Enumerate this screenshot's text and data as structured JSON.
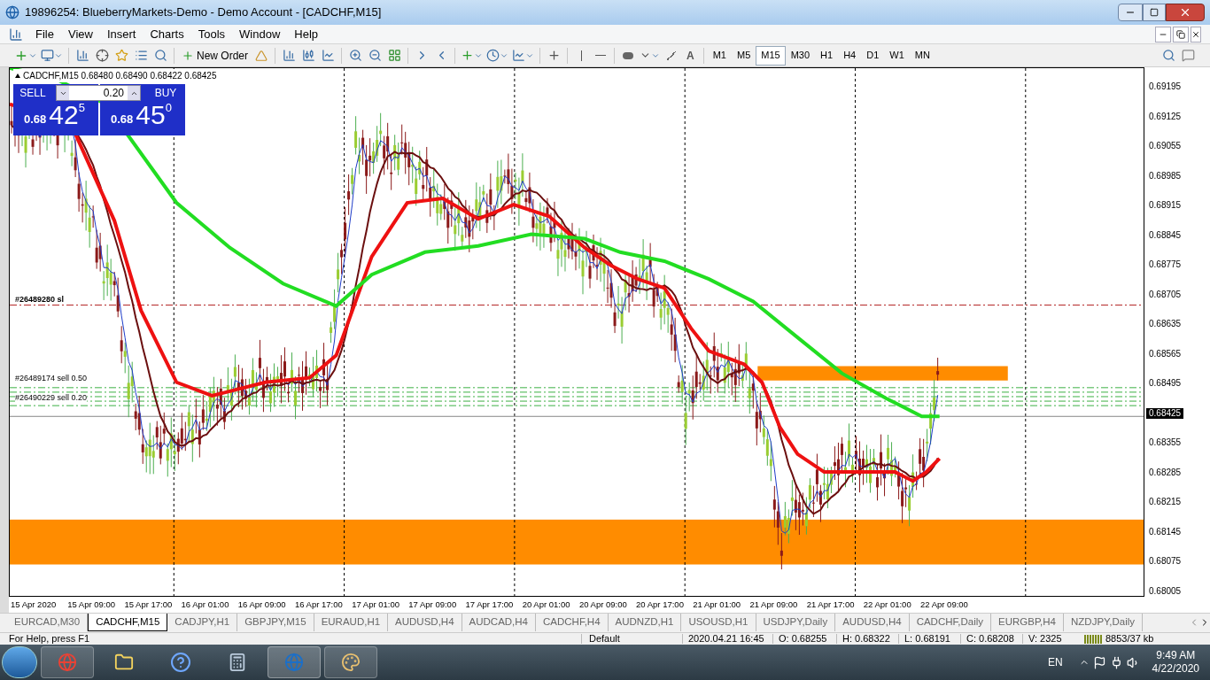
{
  "window": {
    "title": "19896254: BlueberryMarkets-Demo - Demo Account - [CADCHF,M15]"
  },
  "menu": [
    "File",
    "View",
    "Insert",
    "Charts",
    "Tools",
    "Window",
    "Help"
  ],
  "toolbar": {
    "new_order": "New Order",
    "timeframes": [
      {
        "label": "M1",
        "selected": false
      },
      {
        "label": "M5",
        "selected": false
      },
      {
        "label": "M15",
        "selected": true
      },
      {
        "label": "M30",
        "selected": false
      },
      {
        "label": "H1",
        "selected": false
      },
      {
        "label": "H4",
        "selected": false
      },
      {
        "label": "D1",
        "selected": false
      },
      {
        "label": "W1",
        "selected": false
      },
      {
        "label": "MN",
        "selected": false
      }
    ],
    "text_tool": "A"
  },
  "chart": {
    "header": "CADCHF,M15  0.68480 0.68490 0.68422 0.68425",
    "trade_panel": {
      "sell": "SELL",
      "buy": "BUY",
      "lot": "0.20",
      "bid": {
        "prefix": "0.68",
        "big": "42",
        "small": "5"
      },
      "ask": {
        "prefix": "0.68",
        "big": "45",
        "small": "0"
      }
    },
    "order_labels": [
      {
        "text": "#26489280 sl",
        "kind": "sl"
      },
      {
        "text": "#26489174 sell 0.50",
        "kind": "sell"
      },
      {
        "text": "#26490229 sell 0.20",
        "kind": "sell"
      }
    ],
    "price_axis": [
      {
        "label": "0.69195",
        "current": false
      },
      {
        "label": "0.69125",
        "current": false
      },
      {
        "label": "0.69055",
        "current": false
      },
      {
        "label": "0.68985",
        "current": false
      },
      {
        "label": "0.68915",
        "current": false
      },
      {
        "label": "0.68845",
        "current": false
      },
      {
        "label": "0.68775",
        "current": false
      },
      {
        "label": "0.68705",
        "current": false
      },
      {
        "label": "0.68635",
        "current": false
      },
      {
        "label": "0.68565",
        "current": false
      },
      {
        "label": "0.68495",
        "current": false
      },
      {
        "label": "0.68425",
        "current": true
      },
      {
        "label": "0.68355",
        "current": false
      },
      {
        "label": "0.68285",
        "current": false
      },
      {
        "label": "0.68215",
        "current": false
      },
      {
        "label": "0.68145",
        "current": false
      },
      {
        "label": "0.68075",
        "current": false
      },
      {
        "label": "0.68005",
        "current": false
      }
    ],
    "time_axis": [
      "15 Apr 2020",
      "15 Apr 09:00",
      "15 Apr 17:00",
      "16 Apr 01:00",
      "16 Apr 09:00",
      "16 Apr 17:00",
      "17 Apr 01:00",
      "17 Apr 09:00",
      "17 Apr 17:00",
      "20 Apr 01:00",
      "20 Apr 09:00",
      "20 Apr 17:00",
      "21 Apr 01:00",
      "21 Apr 09:00",
      "21 Apr 17:00",
      "22 Apr 01:00",
      "22 Apr 09:00"
    ]
  },
  "tabs": [
    {
      "label": "EURCAD,M30",
      "selected": false
    },
    {
      "label": "CADCHF,M15",
      "selected": true
    },
    {
      "label": "CADJPY,H1",
      "selected": false
    },
    {
      "label": "GBPJPY,M15",
      "selected": false
    },
    {
      "label": "EURAUD,H1",
      "selected": false
    },
    {
      "label": "AUDUSD,H4",
      "selected": false
    },
    {
      "label": "AUDCAD,H4",
      "selected": false
    },
    {
      "label": "CADCHF,H4",
      "selected": false
    },
    {
      "label": "AUDNZD,H1",
      "selected": false
    },
    {
      "label": "USOUSD,H1",
      "selected": false
    },
    {
      "label": "USDJPY,Daily",
      "selected": false
    },
    {
      "label": "AUDUSD,H4",
      "selected": false
    },
    {
      "label": "CADCHF,Daily",
      "selected": false
    },
    {
      "label": "EURGBP,H4",
      "selected": false
    },
    {
      "label": "NZDJPY,Daily",
      "selected": false
    }
  ],
  "status_bar": {
    "help": "For Help, press F1",
    "profile": "Default",
    "time": "2020.04.21 16:45",
    "open": "O: 0.68255",
    "high": "H: 0.68322",
    "low": "L: 0.68191",
    "close": "C: 0.68208",
    "volume": "V: 2325",
    "traffic": "8853/37 kb"
  },
  "taskbar": {
    "language": "EN",
    "clock": "9:49 AM",
    "date": "4/22/2020"
  }
}
